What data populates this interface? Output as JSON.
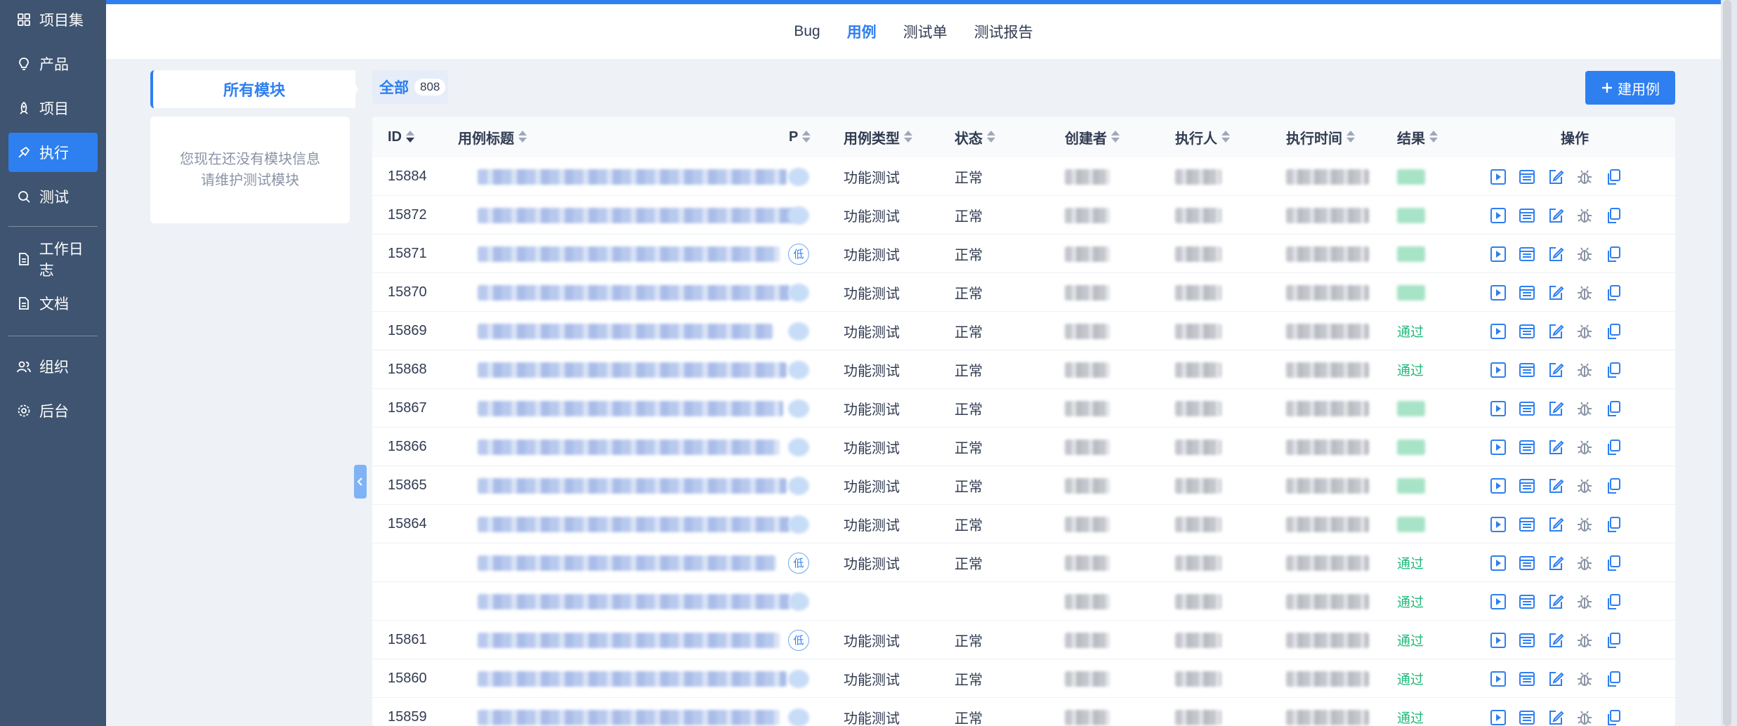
{
  "sidebar": {
    "items": [
      {
        "label": "项目集",
        "icon": "grid-icon"
      },
      {
        "label": "产品",
        "icon": "lightbulb-icon"
      },
      {
        "label": "项目",
        "icon": "rocket-icon"
      },
      {
        "label": "执行",
        "icon": "run-icon",
        "active": true
      },
      {
        "label": "测试",
        "icon": "search-icon"
      },
      {
        "label": "工作日志",
        "icon": "doc-icon"
      },
      {
        "label": "文档",
        "icon": "doc-icon"
      },
      {
        "label": "组织",
        "icon": "users-icon"
      },
      {
        "label": "后台",
        "icon": "gear-icon"
      }
    ]
  },
  "tabs": [
    {
      "label": "Bug"
    },
    {
      "label": "用例",
      "active": true
    },
    {
      "label": "测试单"
    },
    {
      "label": "测试报告"
    }
  ],
  "modules": {
    "title": "所有模块",
    "empty_line1": "您现在还没有模块信息",
    "empty_line2": "请维护测试模块"
  },
  "filter": {
    "all_label": "全部",
    "all_count": "808"
  },
  "toolbar": {
    "create_label": "建用例"
  },
  "table": {
    "headers": {
      "id": "ID",
      "title": "用例标题",
      "pri": "P",
      "type": "用例类型",
      "status": "状态",
      "creator": "创建者",
      "executor": "执行人",
      "exec_time": "执行时间",
      "result": "结果",
      "ops": "操作"
    },
    "rows": [
      {
        "id": "15884",
        "type": "功能测试",
        "status": "正常",
        "pri": "",
        "result": ""
      },
      {
        "id": "15872",
        "type": "功能测试",
        "status": "正常",
        "pri": "",
        "result": ""
      },
      {
        "id": "15871",
        "type": "功能测试",
        "status": "正常",
        "pri": "低",
        "result": ""
      },
      {
        "id": "15870",
        "type": "功能测试",
        "status": "正常",
        "pri": "",
        "result": ""
      },
      {
        "id": "15869",
        "type": "功能测试",
        "status": "正常",
        "pri": "",
        "result": "通过"
      },
      {
        "id": "15868",
        "type": "功能测试",
        "status": "正常",
        "pri": "",
        "result": "通过"
      },
      {
        "id": "15867",
        "type": "功能测试",
        "status": "正常",
        "pri": "",
        "result": ""
      },
      {
        "id": "15866",
        "type": "功能测试",
        "status": "正常",
        "pri": "",
        "result": ""
      },
      {
        "id": "15865",
        "type": "功能测试",
        "status": "正常",
        "pri": "",
        "result": ""
      },
      {
        "id": "15864",
        "type": "功能测试",
        "status": "正常",
        "pri": "",
        "result": ""
      },
      {
        "id": "",
        "type": "功能测试",
        "status": "正常",
        "pri": "低",
        "result": "通过"
      },
      {
        "id": "",
        "type": "",
        "status": "",
        "pri": "",
        "result": "通过"
      },
      {
        "id": "15861",
        "type": "功能测试",
        "status": "正常",
        "pri": "低",
        "result": "通过"
      },
      {
        "id": "15860",
        "type": "功能测试",
        "status": "正常",
        "pri": "",
        "result": "通过"
      },
      {
        "id": "15859",
        "type": "功能测试",
        "status": "正常",
        "pri": "",
        "result": "通过"
      }
    ]
  },
  "colors": {
    "sidebar": "#3e5470",
    "accent": "#2e7ff0",
    "pass": "#1fb97a"
  }
}
